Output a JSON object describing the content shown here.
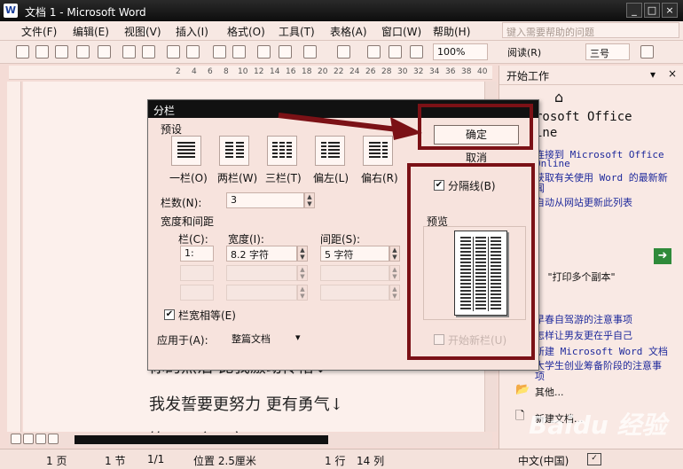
{
  "window": {
    "title": "文档 1 - Microsoft Word",
    "app_icon": "W"
  },
  "menu": {
    "items": [
      "文件(F)",
      "编辑(E)",
      "视图(V)",
      "插入(I)",
      "格式(O)",
      "工具(T)",
      "表格(A)",
      "窗口(W)",
      "帮助(H)"
    ],
    "help_placeholder": "键入需要帮助的问题"
  },
  "toolbar": {
    "zoom": "100%",
    "read_label": "阅读(R)",
    "font_size": "三号"
  },
  "ruler": {
    "ticks": [
      "2",
      "4",
      "6",
      "8",
      "10",
      "12",
      "14",
      "16",
      "18",
      "20",
      "22",
      "24",
      "26",
      "28",
      "30",
      "32",
      "34",
      "36",
      "38",
      "40"
    ]
  },
  "document": {
    "lines": [
      "你的热泪 比我激动怜惜↓",
      "我发誓要更努力 更有勇气↓",
      "等下一个天亮↓"
    ]
  },
  "task_pane": {
    "title": "开始工作",
    "office_line1": "rosoft Office",
    "office_line2": "ine",
    "links": [
      "连接到 Microsoft Office",
      "Online",
      "获取有关使用 Word 的最新新",
      "闻",
      "自动从网站更新此列表"
    ],
    "search_hint": "：  \"打印多个副本\"",
    "recent": [
      "早春自驾游的注意事项",
      "怎样让男友更在乎自己",
      "新建 Microsoft Word 文档",
      "大学生创业筹备阶段的注意事",
      "项"
    ],
    "other": "其他...",
    "new_doc": "新建文档..."
  },
  "dialog": {
    "title": "分栏",
    "preset_label": "预设",
    "presets": [
      "一栏(O)",
      "两栏(W)",
      "三栏(T)",
      "偏左(L)",
      "偏右(R)"
    ],
    "cols_label": "栏数(N):",
    "cols_value": "3",
    "width_spacing_label": "宽度和间距",
    "col_header": "栏(C):",
    "width_header": "宽度(I):",
    "spacing_header": "间距(S):",
    "row1_col": "1:",
    "row1_width": "8.2 字符",
    "row1_spacing": "5 字符",
    "equal_width_label": "栏宽相等(E)",
    "apply_label": "应用于(A):",
    "apply_value": "整篇文档",
    "ok_label": "确定",
    "cancel_label": "取消",
    "separator_label": "分隔线(B)",
    "preview_label": "预览",
    "new_column_label": "开始新栏(U)"
  },
  "status": {
    "page": "1 页",
    "section": "1 节",
    "pages": "1/1",
    "position": "位置 2.5厘米",
    "line": "1 行",
    "col": "14 列",
    "language": "中文(中国)"
  },
  "watermark": "Baidu 经验",
  "colors": {
    "highlight": "#7b1116",
    "background": "#f4dcd6"
  }
}
